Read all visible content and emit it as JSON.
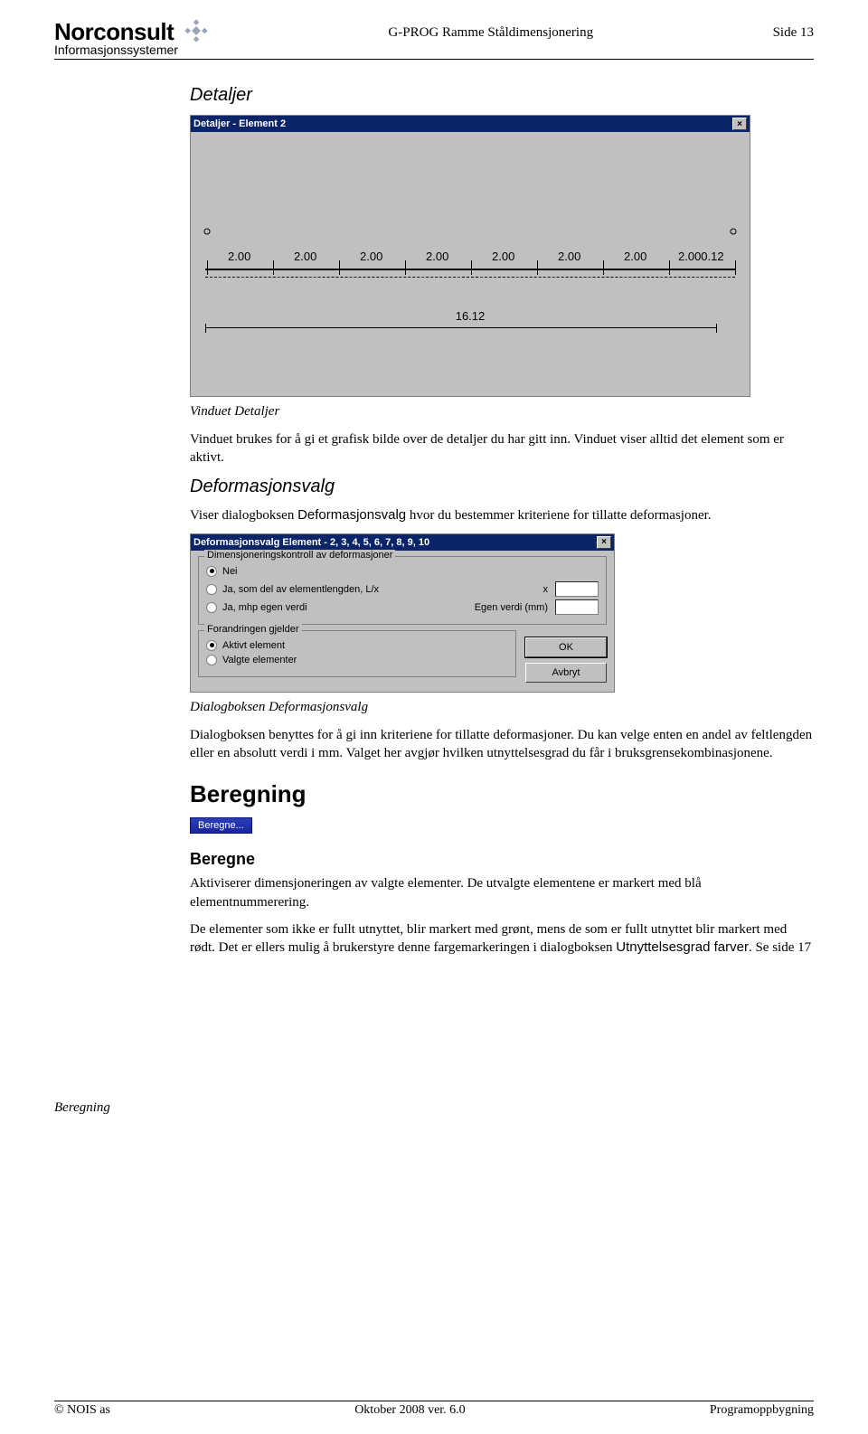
{
  "header": {
    "logo_name": "Norconsult",
    "logo_sub": "Informasjonssystemer",
    "center": "G-PROG Ramme Ståldimensjonering",
    "right": "Side 13"
  },
  "detaljer": {
    "heading": "Detaljer",
    "window_title": "Detaljer - Element 2",
    "segments": [
      "2.00",
      "2.00",
      "2.00",
      "2.00",
      "2.00",
      "2.00",
      "2.00",
      "2.000.12"
    ],
    "total": "16.12",
    "caption": "Vinduet Detaljer",
    "p1": "Vinduet brukes for å gi et grafisk bilde over de detaljer du har gitt inn. Vinduet viser alltid det element som er aktivt."
  },
  "deform": {
    "heading": "Deformasjonsvalg",
    "intro_a": "Viser dialogboksen ",
    "intro_b": "Deformasjonsvalg",
    "intro_c": " hvor du bestemmer kriteriene for tillatte deformasjoner.",
    "dlg_title": "Deformasjonsvalg  Element - 2, 3, 4, 5, 6, 7, 8, 9, 10",
    "group1_title": "Dimensjoneringskontroll av deformasjoner",
    "r1": "Nei",
    "r2": "Ja, som del av elementlengden, L/x",
    "r2_lbl": "x",
    "r3": "Ja, mhp egen verdi",
    "r3_lbl": "Egen verdi (mm)",
    "group2_title": "Forandringen gjelder",
    "r4": "Aktivt element",
    "r5": "Valgte elementer",
    "btn_ok": "OK",
    "btn_cancel": "Avbryt",
    "caption": "Dialogboksen Deformasjonsvalg",
    "p1": "Dialogboksen benyttes for å gi inn kriteriene for tillatte deformasjoner. Du kan velge enten en andel av feltlengden eller en absolutt verdi i mm. Valget her avgjør hvilken utnyttelsesgrad du får i bruksgrensekombinasjonene."
  },
  "beregning": {
    "margin_label": "Beregning",
    "heading": "Beregning",
    "chip": "Beregne...",
    "subhead": "Beregne",
    "p1": "Aktiviserer dimensjoneringen av valgte elementer. De utvalgte elementene er markert med blå elementnummerering.",
    "p2_a": "De elementer som ikke er fullt utnyttet, blir markert med grønt, mens de som er fullt utnyttet blir markert med rødt. Det er ellers mulig å brukerstyre denne fargemarkeringen i dialogboksen ",
    "p2_b": "Utnyttelsesgrad farver",
    "p2_c": ". Se side 17"
  },
  "footer": {
    "left": "© NOIS as",
    "center": "Oktober 2008 ver. 6.0",
    "right": "Programoppbygning"
  }
}
